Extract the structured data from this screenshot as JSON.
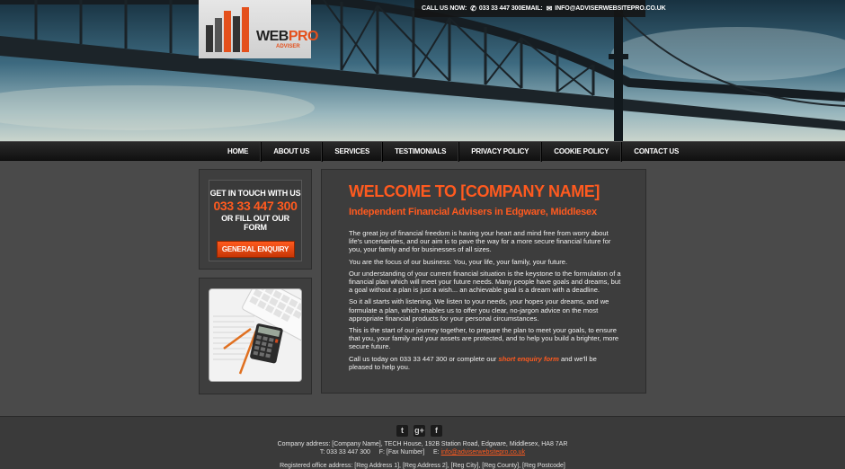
{
  "header": {
    "logo": {
      "word_main": "WEB",
      "word_accent": "PRO",
      "sub": "ADVISER"
    },
    "contact": {
      "call_label": "CALL US NOW:",
      "phone": "033 33 447 300",
      "email_label": "EMAIL:",
      "email": "INFO@ADVISERWEBSITEPRO.CO.UK"
    }
  },
  "nav": {
    "items": [
      "HOME",
      "ABOUT US",
      "SERVICES",
      "TESTIMONIALS",
      "PRIVACY POLICY",
      "COOKIE POLICY",
      "CONTACT US"
    ]
  },
  "sidebar": {
    "cta": {
      "line1": "GET IN TOUCH WITH US",
      "phone": "033 33 447 300",
      "line2": "OR FILL OUT OUR FORM",
      "button": "GENERAL ENQUIRY"
    }
  },
  "main": {
    "title": "WELCOME TO [COMPANY NAME]",
    "subtitle": "Independent Financial Advisers in Edgware, Middlesex",
    "paragraphs": [
      "The great joy of financial freedom is having your heart and mind free from worry about life's uncertainties, and our aim is to pave the way for a more secure financial future for you, your family and for businesses of all sizes.",
      "You are the focus of our business: You, your life, your family, your future.",
      "Our understanding of your current financial situation is the keystone to the formulation of a financial plan which will meet your future needs. Many people have goals and dreams, but a goal without a plan is just a wish... an achievable goal is a dream with a deadline.",
      "So it all starts with listening. We listen to your needs, your hopes your dreams, and we formulate a plan, which enables us to offer you clear, no-jargon advice on the most appropriate financial products for your personal circumstances.",
      "This is the start of our journey together, to prepare the plan to meet your goals, to ensure that you, your family and your assets are protected, and to help you build a brighter, more secure future."
    ],
    "cta_before": "Call us today on 033 33 447 300 or complete our ",
    "cta_link": "short enquiry form",
    "cta_after": " and we'll be pleased to help you."
  },
  "footer": {
    "social": [
      "twitter-icon",
      "google-plus-icon",
      "facebook-icon"
    ],
    "company_address": "Company address: [Company Name], TECH House, 192B Station Road, Edgware, Middlesex, HA8 7AR",
    "tel": "T: 033 33 447 300",
    "fax": "F: [Fax Number]",
    "email_label": "E:",
    "email": "info@adviserwebsitepro.co.uk",
    "registered": "Registered office address: [Reg Address 1], [Reg Address 2], [Reg City], [Reg County], [Reg Postcode]"
  },
  "colors": {
    "accent": "#ff5a1f",
    "background": "#4a4a4a",
    "panel": "#3d3d3d"
  }
}
